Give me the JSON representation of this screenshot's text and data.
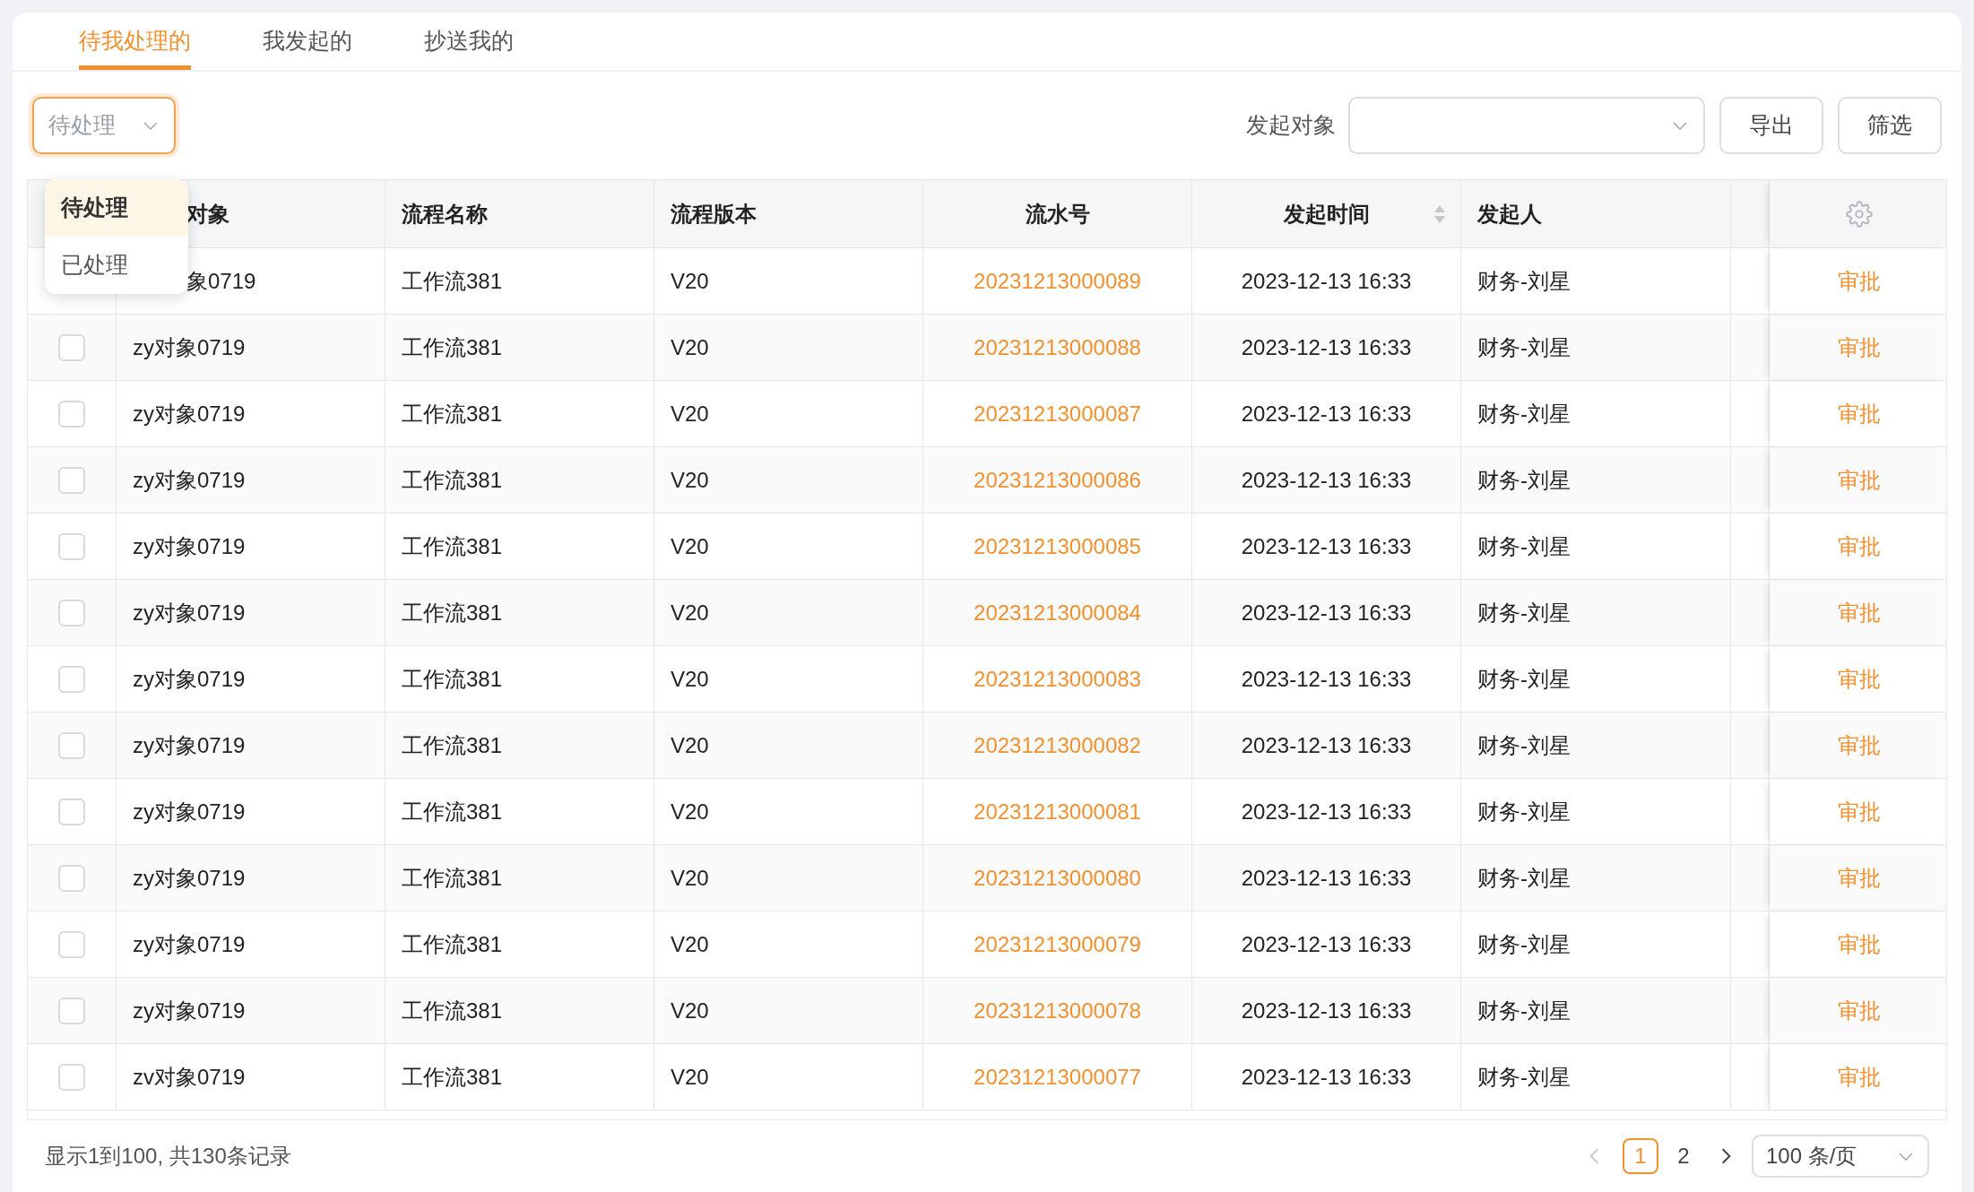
{
  "tabs": [
    {
      "label": "待我处理的",
      "selected": true
    },
    {
      "label": "我发起的",
      "selected": false
    },
    {
      "label": "抄送我的",
      "selected": false
    }
  ],
  "status_select": {
    "value": "待处理",
    "open": true,
    "options": [
      {
        "label": "待处理",
        "selected": true
      },
      {
        "label": "已处理",
        "selected": false
      }
    ]
  },
  "initiator_filter": {
    "label": "发起对象"
  },
  "buttons": [
    "导出",
    "筛选"
  ],
  "table": {
    "columns": [
      "对象",
      "流程名称",
      "流程版本",
      "流水号",
      "发起时间",
      "发起人"
    ],
    "rows": [
      {
        "object": "象0719",
        "workflow": "工作流381",
        "version": "V20",
        "serial": "20231213000089",
        "time": "2023-12-13 16:33",
        "initiator": "财务-刘星",
        "action": "审批"
      },
      {
        "checked": false,
        "object": "zy对象0719",
        "workflow": "工作流381",
        "version": "V20",
        "serial": "20231213000088",
        "time": "2023-12-13 16:33",
        "initiator": "财务-刘星",
        "action": "审批"
      },
      {
        "checked": false,
        "object": "zy对象0719",
        "workflow": "工作流381",
        "version": "V20",
        "serial": "20231213000087",
        "time": "2023-12-13 16:33",
        "initiator": "财务-刘星",
        "action": "审批"
      },
      {
        "checked": false,
        "object": "zy对象0719",
        "workflow": "工作流381",
        "version": "V20",
        "serial": "20231213000086",
        "time": "2023-12-13 16:33",
        "initiator": "财务-刘星",
        "action": "审批"
      },
      {
        "checked": false,
        "object": "zy对象0719",
        "workflow": "工作流381",
        "version": "V20",
        "serial": "20231213000085",
        "time": "2023-12-13 16:33",
        "initiator": "财务-刘星",
        "action": "审批"
      },
      {
        "checked": false,
        "object": "zy对象0719",
        "workflow": "工作流381",
        "version": "V20",
        "serial": "20231213000084",
        "time": "2023-12-13 16:33",
        "initiator": "财务-刘星",
        "action": "审批"
      },
      {
        "checked": false,
        "object": "zy对象0719",
        "workflow": "工作流381",
        "version": "V20",
        "serial": "20231213000083",
        "time": "2023-12-13 16:33",
        "initiator": "财务-刘星",
        "action": "审批"
      },
      {
        "checked": false,
        "object": "zy对象0719",
        "workflow": "工作流381",
        "version": "V20",
        "serial": "20231213000082",
        "time": "2023-12-13 16:33",
        "initiator": "财务-刘星",
        "action": "审批"
      },
      {
        "checked": false,
        "object": "zy对象0719",
        "workflow": "工作流381",
        "version": "V20",
        "serial": "20231213000081",
        "time": "2023-12-13 16:33",
        "initiator": "财务-刘星",
        "action": "审批"
      },
      {
        "checked": false,
        "object": "zy对象0719",
        "workflow": "工作流381",
        "version": "V20",
        "serial": "20231213000080",
        "time": "2023-12-13 16:33",
        "initiator": "财务-刘星",
        "action": "审批"
      },
      {
        "checked": false,
        "object": "zy对象0719",
        "workflow": "工作流381",
        "version": "V20",
        "serial": "20231213000079",
        "time": "2023-12-13 16:33",
        "initiator": "财务-刘星",
        "action": "审批"
      },
      {
        "checked": false,
        "object": "zy对象0719",
        "workflow": "工作流381",
        "version": "V20",
        "serial": "20231213000078",
        "time": "2023-12-13 16:33",
        "initiator": "财务-刘星",
        "action": "审批"
      },
      {
        "checked": false,
        "object": "zv对象0719",
        "workflow": "工作流381",
        "version": "V20",
        "serial": "20231213000077",
        "time": "2023-12-13 16:33",
        "initiator": "财务-刘星",
        "action": "审批"
      }
    ]
  },
  "summary": "显示1到100, 共130条记录",
  "pagination": {
    "prev_disabled": true,
    "pages": [
      {
        "label": "1",
        "selected": true
      },
      {
        "label": "2",
        "selected": false
      }
    ],
    "page_size": "100 条/页"
  }
}
